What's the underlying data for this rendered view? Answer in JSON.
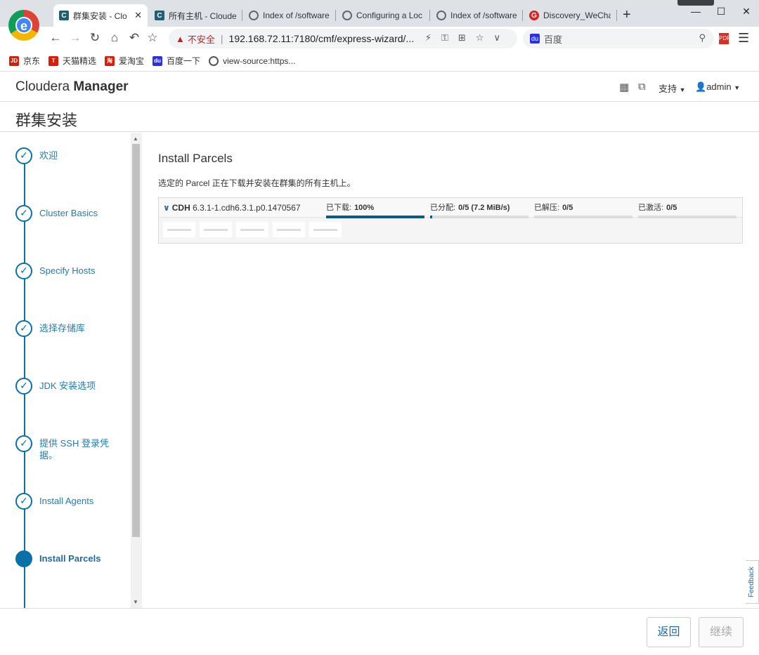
{
  "browser": {
    "tabs": [
      {
        "label": "群集安装 - Clo",
        "icon": "cloudera-c-icon",
        "active": true
      },
      {
        "label": "所有主机 - Cloude",
        "icon": "cloudera-c-icon"
      },
      {
        "label": "Index of /software",
        "icon": "globe-icon"
      },
      {
        "label": "Configuring a Loc",
        "icon": "globe-icon"
      },
      {
        "label": "Index of /software",
        "icon": "globe-icon"
      },
      {
        "label": "Discovery_WeCha",
        "icon": "red-g-icon"
      }
    ],
    "url_insecure": "不安全",
    "url": "192.168.72.11:7180/cmf/express-wizard/...",
    "search_placeholder": "百度",
    "bookmarks": [
      {
        "label": "京东",
        "icon": "JD",
        "color": "#d81e06"
      },
      {
        "label": "天猫精选",
        "icon": "T",
        "color": "#d81e06"
      },
      {
        "label": "爱淘宝",
        "icon": "淘",
        "color": "#d81e06"
      },
      {
        "label": "百度一下",
        "icon": "du",
        "color": "#2932e1"
      },
      {
        "label": "view-source:https...",
        "icon": "globe",
        "color": "#555555"
      }
    ]
  },
  "header": {
    "brand_light": "Cloudera",
    "brand_bold": "Manager",
    "support": "支持",
    "user": "admin"
  },
  "page_title": "群集安装",
  "steps": [
    {
      "label": "欢迎",
      "done": true
    },
    {
      "label": "Cluster Basics",
      "done": true
    },
    {
      "label": "Specify Hosts",
      "done": true
    },
    {
      "label": "选择存储库",
      "done": true
    },
    {
      "label": "JDK 安装选项",
      "done": true
    },
    {
      "label": "提供 SSH 登录凭据。",
      "done": true
    },
    {
      "label": "Install Agents",
      "done": true
    },
    {
      "label": "Install Parcels",
      "current": true
    }
  ],
  "main": {
    "title": "Install Parcels",
    "description": "选定的 Parcel 正在下载并安装在群集的所有主机上。",
    "parcel": {
      "name": "CDH",
      "version": "6.3.1-1.cdh6.3.1.p0.1470567",
      "stages": [
        {
          "label": "已下载:",
          "value": "100%",
          "progress": 1.0
        },
        {
          "label": "已分配:",
          "value": "0/5 (7.2 MiB/s)",
          "progress": 0.02
        },
        {
          "label": "已解压:",
          "value": "0/5",
          "progress": 0
        },
        {
          "label": "已激活:",
          "value": "0/5",
          "progress": 0
        }
      ],
      "host_count": 5
    }
  },
  "feedback": "Feedback",
  "footer": {
    "back": "返回",
    "next": "继续"
  },
  "colors": {
    "accent": "#0a70a8",
    "progress": "#0a5a8c",
    "insecure": "#c5221f"
  }
}
